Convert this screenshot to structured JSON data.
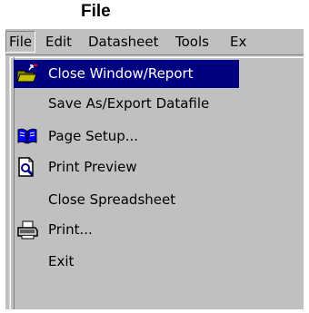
{
  "caption": "File",
  "menubar": {
    "items": [
      {
        "label": "File"
      },
      {
        "label": "Edit"
      },
      {
        "label": "Datasheet"
      },
      {
        "label": "Tools"
      },
      {
        "label": "Ex"
      }
    ]
  },
  "file_menu": {
    "items": [
      {
        "label": "Close Window/Report",
        "icon": "close-window-folder-icon",
        "highlighted": true
      },
      {
        "label": "Save As/Export Datafile",
        "icon": ""
      },
      {
        "label": "Page Setup...",
        "icon": "open-book-icon"
      },
      {
        "label": "Print Preview",
        "icon": "print-preview-magnifier-icon"
      },
      {
        "label": "Close Spreadsheet",
        "icon": ""
      },
      {
        "label": "Print...",
        "icon": "printer-icon"
      },
      {
        "label": "Exit",
        "icon": ""
      }
    ]
  },
  "colors": {
    "menu_face": "#c0c0c0",
    "highlight": "#000080",
    "highlight_text": "#ffffff"
  }
}
